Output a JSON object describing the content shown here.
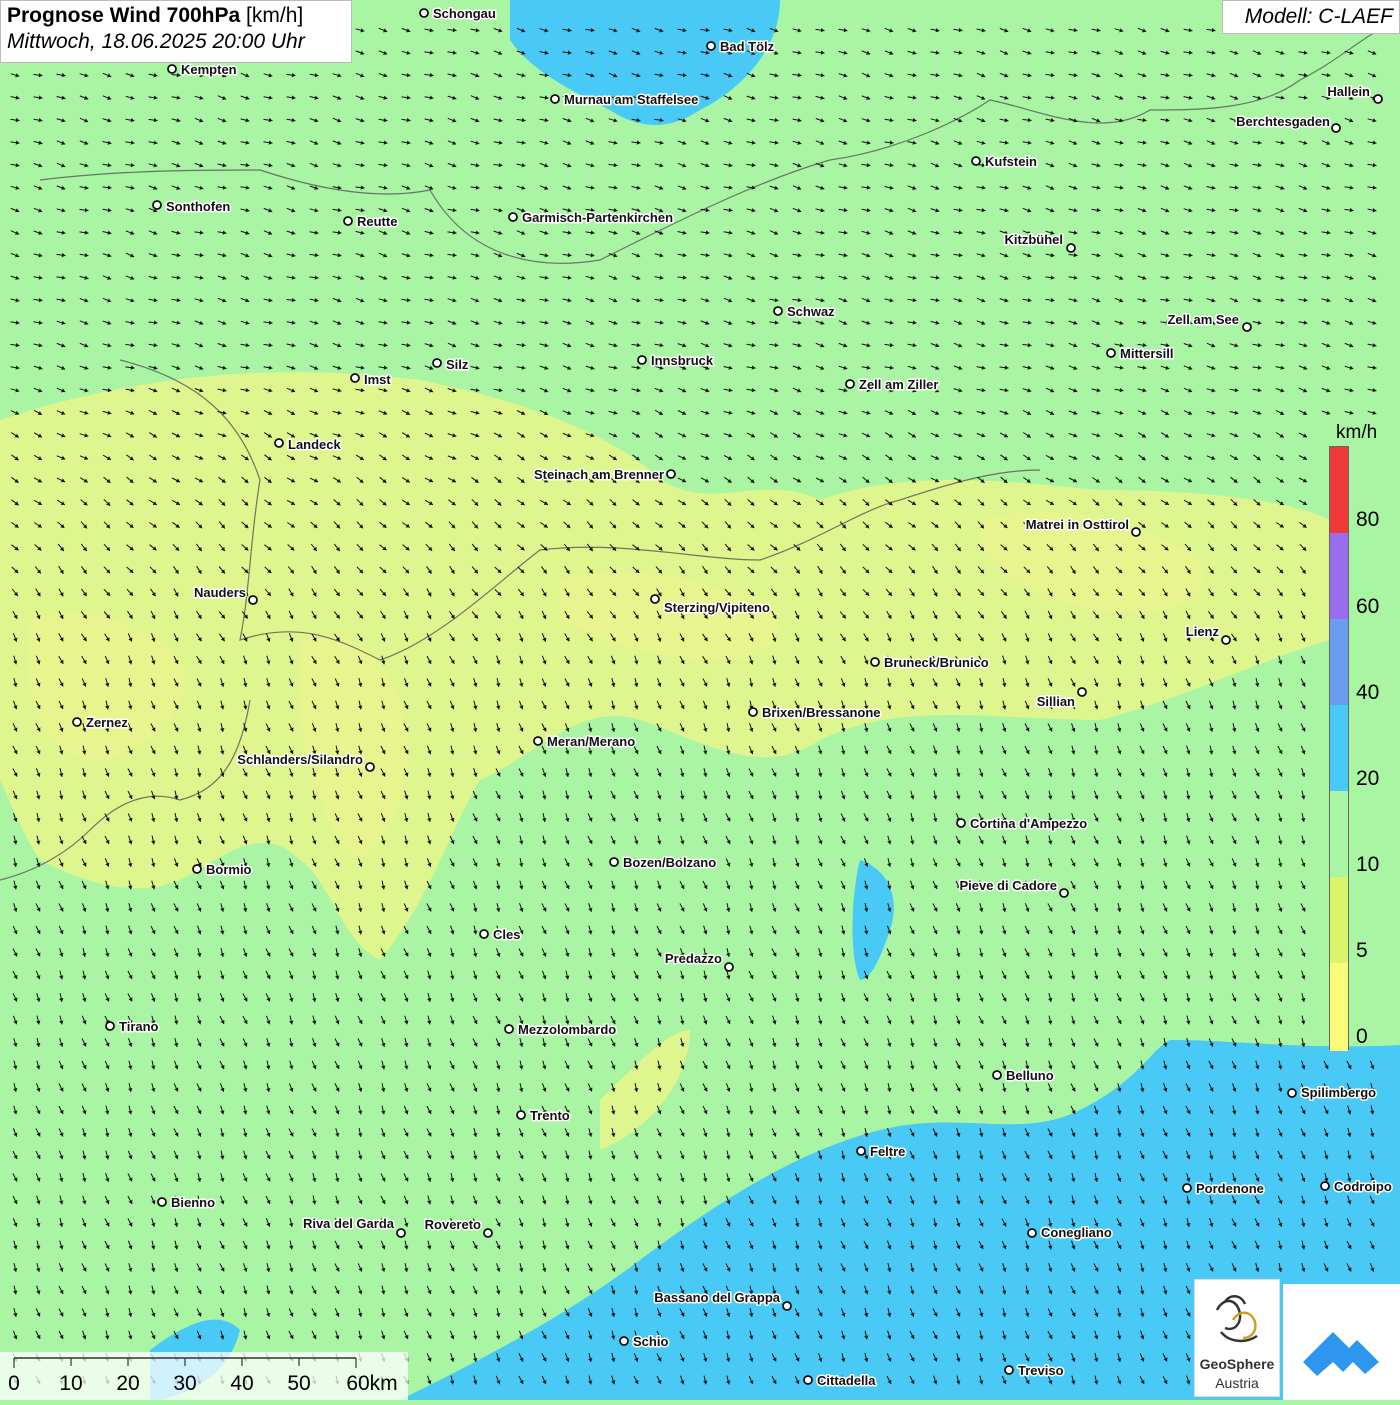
{
  "header": {
    "title_bold": "Prognose Wind 700hPa",
    "title_unit": " [km/h]",
    "subtitle": "Mittwoch, 18.06.2025 20:00 Uhr",
    "model": "Modell: C-LAEF"
  },
  "legend": {
    "unit": "km/h",
    "labels": [
      "80",
      "60",
      "40",
      "20",
      "10",
      "5",
      "0"
    ],
    "colors": {
      "0-5": "#fbfb7a",
      "5-10": "#d9f56b",
      "10-20": "#a9f5a3",
      "20-40": "#49c9f5",
      "40-60": "#6a9df0",
      "60-80": "#9a6cf0",
      "80+": "#f03a3a"
    }
  },
  "scale_bar": {
    "labels": [
      "0",
      "10",
      "20",
      "30",
      "40",
      "50",
      "60km"
    ]
  },
  "logos": {
    "org_line1": "GeoSphere",
    "org_line2": "Austria"
  },
  "cities": [
    {
      "name": "Schongau"
    },
    {
      "name": "Bad Tölz"
    },
    {
      "name": "Kempten"
    },
    {
      "name": "Murnau am Staffelsee"
    },
    {
      "name": "Hallein"
    },
    {
      "name": "Berchtesgaden"
    },
    {
      "name": "Kufstein"
    },
    {
      "name": "Sonthofen"
    },
    {
      "name": "Reutte"
    },
    {
      "name": "Garmisch-Partenkirchen"
    },
    {
      "name": "Kitzbühel"
    },
    {
      "name": "Schwaz"
    },
    {
      "name": "Zell am See"
    },
    {
      "name": "Mittersill"
    },
    {
      "name": "Innsbruck"
    },
    {
      "name": "Silz"
    },
    {
      "name": "Imst"
    },
    {
      "name": "Zell am Ziller"
    },
    {
      "name": "Landeck"
    },
    {
      "name": "Steinach am Brenner"
    },
    {
      "name": "Matrei in Osttirol"
    },
    {
      "name": "Nauders"
    },
    {
      "name": "Sterzing/Vipiteno"
    },
    {
      "name": "Lienz"
    },
    {
      "name": "Bruneck/Brunico"
    },
    {
      "name": "Sillian"
    },
    {
      "name": "Zernez"
    },
    {
      "name": "Brixen/Bressanone"
    },
    {
      "name": "Meran/Merano"
    },
    {
      "name": "Schlanders/Silandro"
    },
    {
      "name": "Cortina d'Ampezzo"
    },
    {
      "name": "Bozen/Bolzano"
    },
    {
      "name": "Bormio"
    },
    {
      "name": "Pieve di Cadore"
    },
    {
      "name": "Cles"
    },
    {
      "name": "Predazzo"
    },
    {
      "name": "Tirano"
    },
    {
      "name": "Mezzolombardo"
    },
    {
      "name": "Belluno"
    },
    {
      "name": "Spilimbergo"
    },
    {
      "name": "Trento"
    },
    {
      "name": "Feltre"
    },
    {
      "name": "Bienno"
    },
    {
      "name": "Pordenone"
    },
    {
      "name": "Codroipo"
    },
    {
      "name": "Riva del Garda"
    },
    {
      "name": "Rovereto"
    },
    {
      "name": "Conegliano"
    },
    {
      "name": "Bassano del Grappa"
    },
    {
      "name": "Schio"
    },
    {
      "name": "Treviso"
    },
    {
      "name": "Cittadella"
    }
  ]
}
